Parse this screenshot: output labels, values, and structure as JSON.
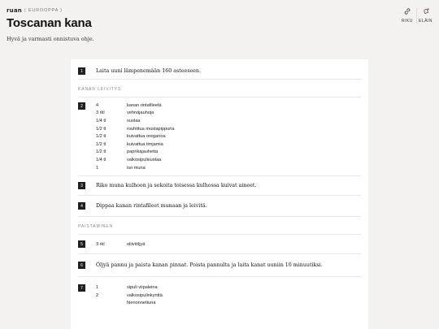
{
  "header": {
    "logo": "ruan",
    "breadcrumb": "( EUROOPPA )",
    "title": "Toscanan kana",
    "intro": "Hyvä ja varmasti onnistuva ohje.",
    "actions": [
      {
        "label": "RIKU",
        "icon": "link-icon"
      },
      {
        "label": "ELÄIN",
        "icon": "bell-icon"
      }
    ]
  },
  "steps": {
    "s1": {
      "num": "1",
      "text": "Laita uuni lämpenemään 160 asteeseen."
    },
    "section1": "KANAN LEIVITYS",
    "s2": {
      "num": "2",
      "ingredients": [
        {
          "amount": "4",
          "name": "kanan rintafileetä"
        },
        {
          "amount": "3 rkl",
          "name": "vehnäjauhoja"
        },
        {
          "amount": "1/4 tl",
          "name": "suolaa"
        },
        {
          "amount": "1/2 tl",
          "name": "rouhittua mustapippuria"
        },
        {
          "amount": "1/2 tl",
          "name": "kuivattua oreganoa"
        },
        {
          "amount": "1/2 tl",
          "name": "kuivattua timjamia"
        },
        {
          "amount": "1/2 tl",
          "name": "paprikajauhetta"
        },
        {
          "amount": "1/4 tl",
          "name": "valkosipulisuolaa"
        },
        {
          "amount": "1",
          "name": "iso muna"
        }
      ]
    },
    "s3": {
      "num": "3",
      "text": "Riko muna kulhoon ja sekoita toisessa kulhossa kuivat aineet."
    },
    "s4": {
      "num": "4",
      "text": "Dippaa kanan rintafileet munaan ja leivitä."
    },
    "section2": "PAISTAMINEN",
    "s5": {
      "num": "5",
      "amount": "3 rkl",
      "name": "oliiviöljyä"
    },
    "s6": {
      "num": "6",
      "text": "Öljyä pannu ja paista kanan pinnat. Poista pannulta ja laita kanat uuniin 10 minuutiksi."
    },
    "s7": {
      "num": "7",
      "ingredients": [
        {
          "amount": "1",
          "name": "sipuli viipaleina"
        },
        {
          "amount": "2",
          "name": "valkosipulinkynttä"
        },
        {
          "amount": "",
          "name": "hienonnettuna"
        }
      ]
    }
  }
}
